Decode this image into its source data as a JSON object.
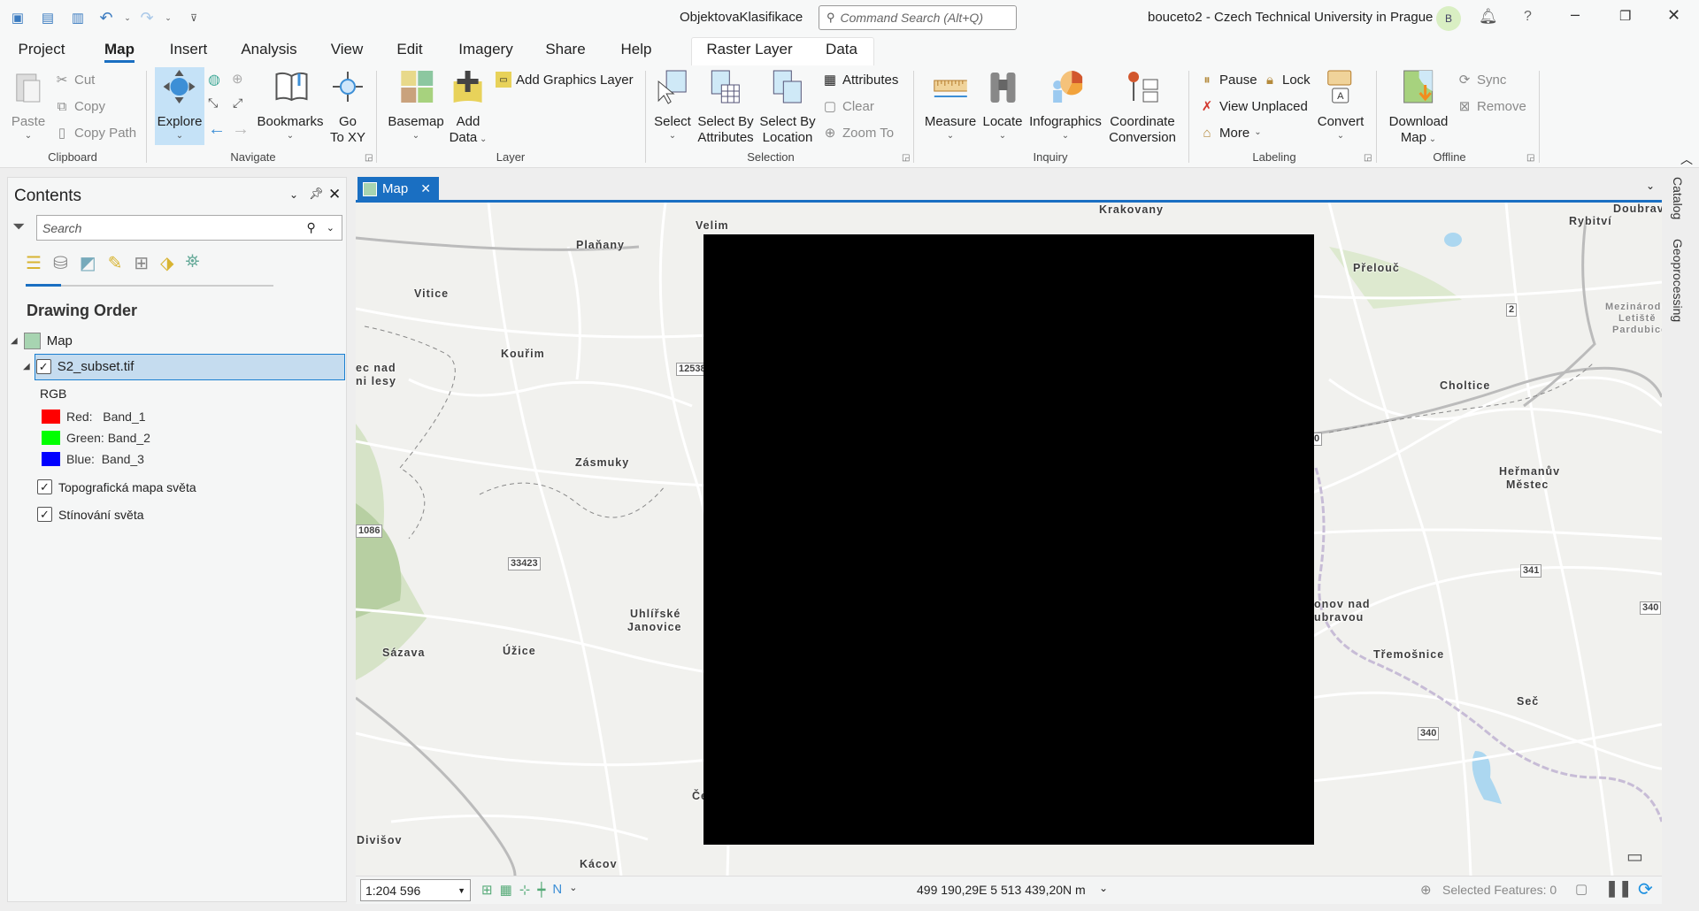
{
  "titlebar": {
    "project_name": "ObjektovaKlasifikace",
    "search_placeholder": "Command Search (Alt+Q)",
    "user": "bouceto2 - Czech Technical University in Prague",
    "avatar_initial": "B",
    "help": "?"
  },
  "tabs": [
    "Project",
    "Map",
    "Insert",
    "Analysis",
    "View",
    "Edit",
    "Imagery",
    "Share",
    "Help"
  ],
  "active_tab": "Map",
  "context_tabs": [
    "Raster Layer",
    "Data"
  ],
  "ribbon": {
    "clipboard": {
      "label": "Clipboard",
      "paste": "Paste",
      "cut": "Cut",
      "copy": "Copy",
      "copy_path": "Copy Path"
    },
    "navigate": {
      "label": "Navigate",
      "explore": "Explore",
      "bookmarks": "Bookmarks",
      "goto1": "Go",
      "goto2": "To XY"
    },
    "layer": {
      "label": "Layer",
      "basemap": "Basemap",
      "add1": "Add",
      "add2": "Data",
      "add_graphics": "Add Graphics Layer"
    },
    "selection": {
      "label": "Selection",
      "select": "Select",
      "sba1": "Select By",
      "sba2": "Attributes",
      "sbl1": "Select By",
      "sbl2": "Location",
      "attributes": "Attributes",
      "clear": "Clear",
      "zoom_to": "Zoom To"
    },
    "inquiry": {
      "label": "Inquiry",
      "measure": "Measure",
      "locate": "Locate",
      "infographics": "Infographics",
      "cc1": "Coordinate",
      "cc2": "Conversion"
    },
    "labeling": {
      "label": "Labeling",
      "pause": "Pause",
      "lock": "Lock",
      "view_unplaced": "View Unplaced",
      "more": "More",
      "convert": "Convert"
    },
    "offline": {
      "label": "Offline",
      "dl1": "Download",
      "dl2": "Map",
      "sync": "Sync",
      "remove": "Remove"
    }
  },
  "contents": {
    "title": "Contents",
    "search_placeholder": "Search",
    "heading": "Drawing Order",
    "map": "Map",
    "layers": [
      {
        "name": "S2_subset.tif",
        "checked": true,
        "selected": true
      },
      {
        "name": "Topografická mapa světa",
        "checked": true
      },
      {
        "name": "Stínování světa",
        "checked": true
      }
    ],
    "renderer": "RGB",
    "bands": [
      {
        "label": "Red:   Band_1",
        "color": "#ff0000"
      },
      {
        "label": "Green: Band_2",
        "color": "#00ff00"
      },
      {
        "label": "Blue:  Band_3",
        "color": "#0000ff"
      }
    ]
  },
  "map_view": {
    "tab": "Map",
    "places": [
      "Krakovany",
      "Velim",
      "Plaňany",
      "Vitice",
      "Kouřim",
      "ec nad",
      "ni lesy",
      "Zásmuky",
      "Uhlířské",
      "Janovice",
      "Úžice",
      "Sázava",
      "Divišov",
      "Kácov",
      "Če",
      "Doubrav",
      "Rybitví",
      "Přelouč",
      "Mezinárodní",
      "Letiště",
      "Pardubice",
      "Choltice",
      "Heřmanův",
      "Městec",
      "onov nad",
      "ubravou",
      "Třemošnice",
      "Seč"
    ],
    "road_shields": [
      "12538",
      "1086",
      "33423",
      "2",
      "341",
      "340",
      "340",
      "0"
    ]
  },
  "side_tabs": [
    "Catalog",
    "Geoprocessing"
  ],
  "status": {
    "scale": "1:204 596",
    "coordinates": "499 190,29E 5 513 439,20N m",
    "selected_features": "Selected Features: 0"
  }
}
